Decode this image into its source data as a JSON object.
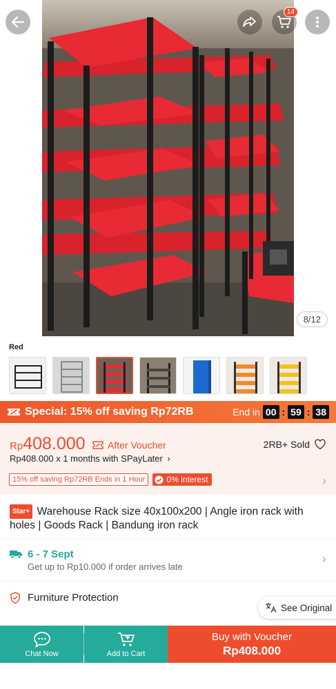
{
  "gallery": {
    "counter": "8/12",
    "cart_badge": "14",
    "variant_label": "Red",
    "thumbnails": [
      {
        "color": "black"
      },
      {
        "color": "grey"
      },
      {
        "color": "red",
        "selected": true
      },
      {
        "color": "black"
      },
      {
        "color": "blue"
      },
      {
        "color": "orange"
      },
      {
        "color": "yellow"
      }
    ]
  },
  "special": {
    "text": "Special: 15% off saving Rp72RB",
    "ends_label": "End in",
    "hours": "00",
    "minutes": "59",
    "seconds": "38"
  },
  "price": {
    "currency": "Rp",
    "amount": "408.000",
    "after_voucher": "After Voucher",
    "sold": "2RB+ Sold",
    "spaylater": "Rp408.000 x 1 months with SPayLater",
    "promo_tag": "15% off saving Rp72RB Ends in 1 Hour",
    "interest": "0% interest"
  },
  "product": {
    "badge": "Star+",
    "title": "Warehouse Rack size 40x100x200 | Angle iron rack with holes | Goods Rack | Bandung iron rack"
  },
  "shipping": {
    "date": "6 - 7 Sept",
    "note": "Get up to Rp10.000 if order arrives late"
  },
  "protection": {
    "label": "Furniture Protection"
  },
  "translate": {
    "label": "See Original"
  },
  "bottom_bar": {
    "chat": "Chat Now",
    "cart": "Add to Cart",
    "buy_line1": "Buy with Voucher",
    "buy_line2": "Rp408.000"
  },
  "colors": {
    "brand": "#ee4d2d",
    "teal": "#26aa99"
  }
}
